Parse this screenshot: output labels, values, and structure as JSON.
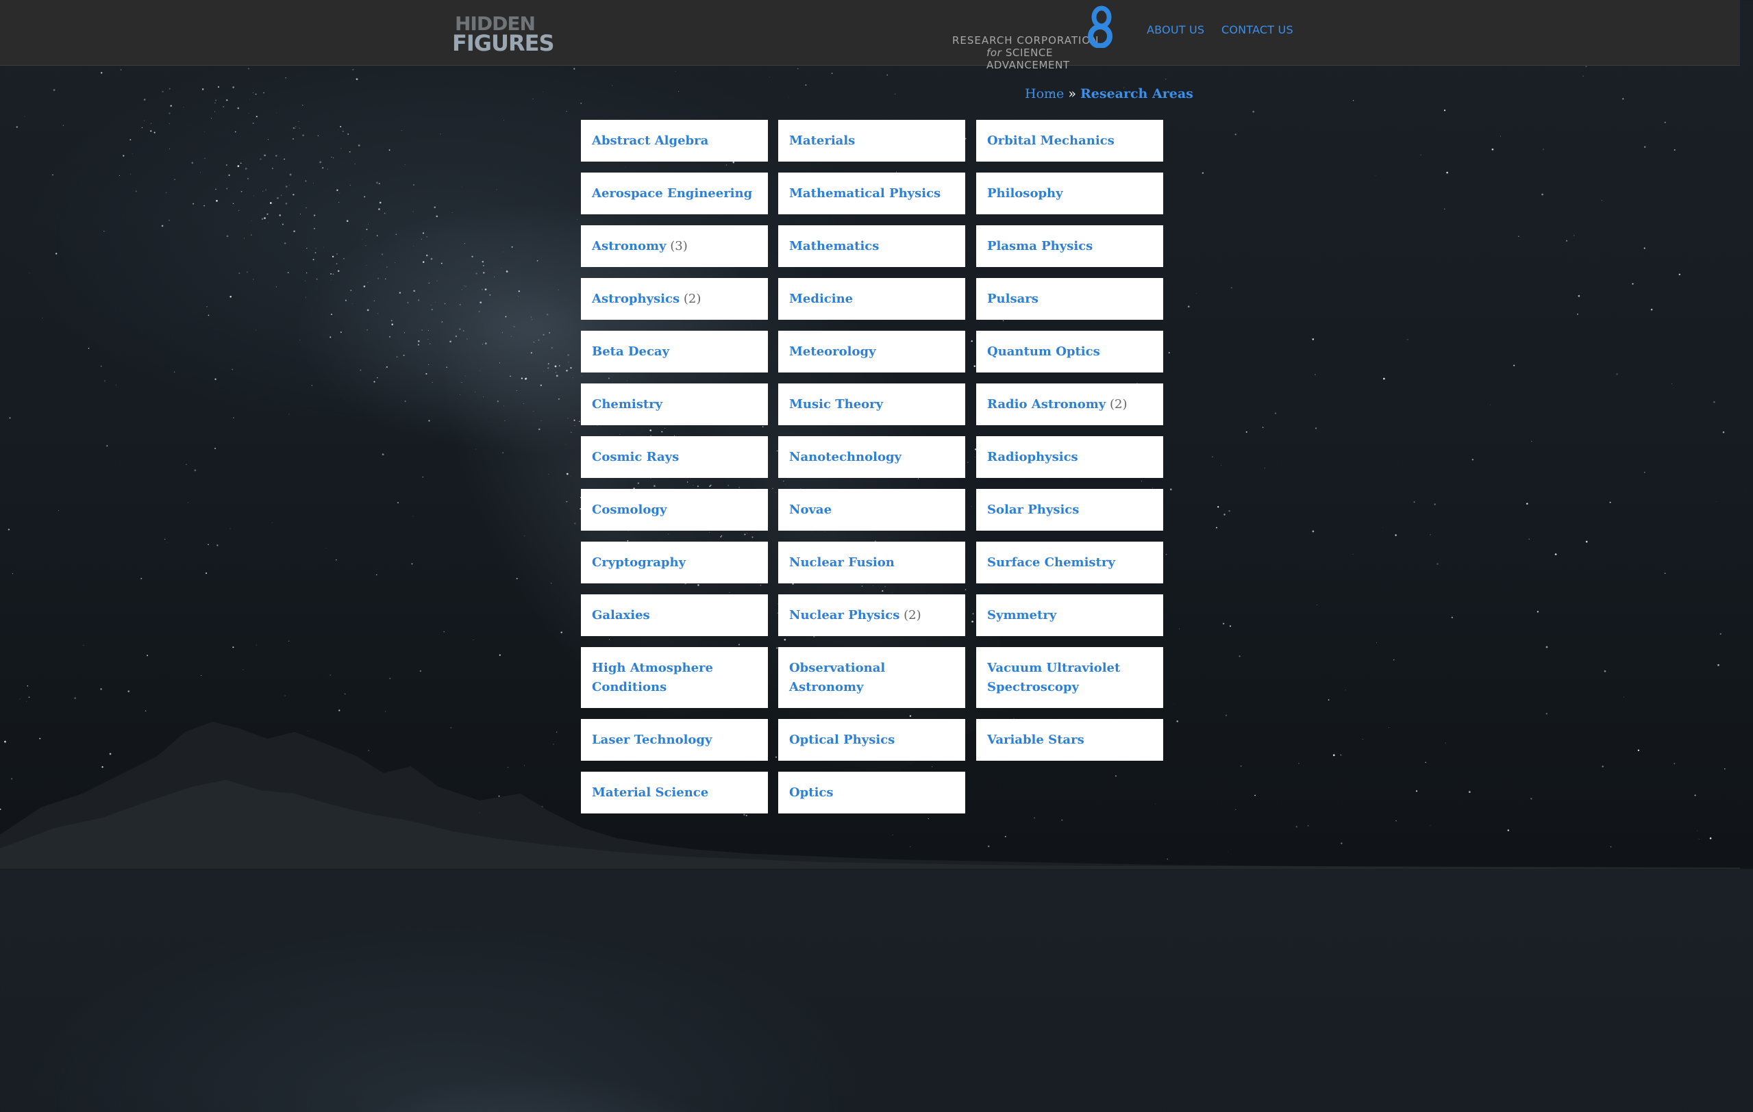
{
  "header": {
    "logo_text": "HIDDEN FIGURES",
    "org_logo_line1": "RESEARCH CORPORATION",
    "org_logo_for": "for",
    "org_logo_line2": "SCIENCE ADVANCEMENT",
    "nav": [
      {
        "label": "ABOUT US"
      },
      {
        "label": "CONTACT US"
      }
    ]
  },
  "breadcrumb": {
    "home": "Home",
    "separator": "»",
    "current": "Research Areas"
  },
  "columns": [
    [
      {
        "label": "Abstract Algebra",
        "count": ""
      },
      {
        "label": "Aerospace Engineering",
        "count": ""
      },
      {
        "label": "Astronomy",
        "count": "(3)"
      },
      {
        "label": "Astrophysics",
        "count": "(2)"
      },
      {
        "label": "Beta Decay",
        "count": ""
      },
      {
        "label": "Chemistry",
        "count": ""
      },
      {
        "label": "Cosmic Rays",
        "count": ""
      },
      {
        "label": "Cosmology",
        "count": ""
      },
      {
        "label": "Cryptography",
        "count": ""
      },
      {
        "label": "Galaxies",
        "count": ""
      },
      {
        "label": "High Atmosphere Conditions",
        "count": ""
      },
      {
        "label": "Laser Technology",
        "count": ""
      },
      {
        "label": "Material Science",
        "count": ""
      }
    ],
    [
      {
        "label": "Materials",
        "count": ""
      },
      {
        "label": "Mathematical Physics",
        "count": ""
      },
      {
        "label": "Mathematics",
        "count": ""
      },
      {
        "label": "Medicine",
        "count": ""
      },
      {
        "label": "Meteorology",
        "count": ""
      },
      {
        "label": "Music Theory",
        "count": ""
      },
      {
        "label": "Nanotechnology",
        "count": ""
      },
      {
        "label": "Novae",
        "count": ""
      },
      {
        "label": "Nuclear Fusion",
        "count": ""
      },
      {
        "label": "Nuclear Physics",
        "count": "(2)"
      },
      {
        "label": "Observational Astronomy",
        "count": ""
      },
      {
        "label": "Optical Physics",
        "count": ""
      },
      {
        "label": "Optics",
        "count": ""
      }
    ],
    [
      {
        "label": "Orbital Mechanics",
        "count": ""
      },
      {
        "label": "Philosophy",
        "count": ""
      },
      {
        "label": "Plasma Physics",
        "count": ""
      },
      {
        "label": "Pulsars",
        "count": ""
      },
      {
        "label": "Quantum Optics",
        "count": ""
      },
      {
        "label": "Radio Astronomy",
        "count": "(2)"
      },
      {
        "label": "Radiophysics",
        "count": ""
      },
      {
        "label": "Solar Physics",
        "count": ""
      },
      {
        "label": "Surface Chemistry",
        "count": ""
      },
      {
        "label": "Symmetry",
        "count": ""
      },
      {
        "label": "Vacuum Ultraviolet Spectroscopy",
        "count": ""
      },
      {
        "label": "Variable Stars",
        "count": ""
      }
    ]
  ],
  "colors": {
    "header_bg": "#2b2b2b",
    "link": "#3d8fe8",
    "card_link": "#2e7fd6",
    "card_bg": "#ffffff",
    "count_text": "#666666"
  }
}
